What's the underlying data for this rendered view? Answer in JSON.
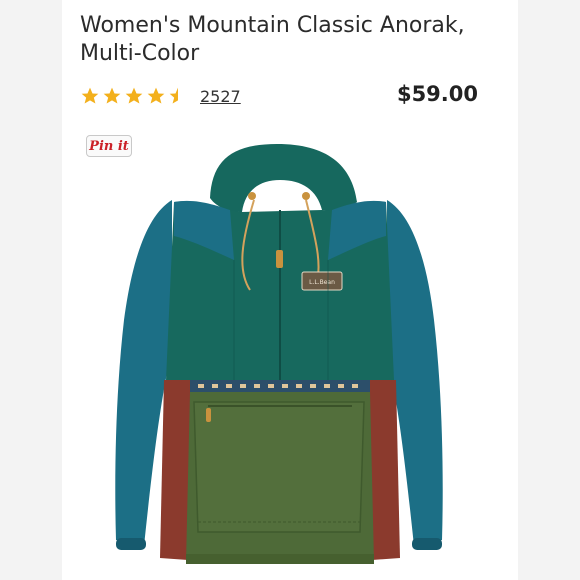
{
  "product": {
    "title": "Women's Mountain Classic Anorak, Multi-Color",
    "rating": 4.5,
    "reviews_count": "2527",
    "price": "$59.00",
    "brand_patch": "L.L.Bean"
  },
  "pin_button": {
    "label": "Pin it"
  },
  "colors": {
    "star": "#f3b01c",
    "teal_body": "#16685e",
    "blue_sleeve": "#1c6f86",
    "olive": "#4e6a38",
    "rust": "#8b3a2d",
    "pin_red": "#cb2027"
  },
  "icons": [
    "star-icon",
    "pinterest-pin-button",
    "product-image"
  ]
}
